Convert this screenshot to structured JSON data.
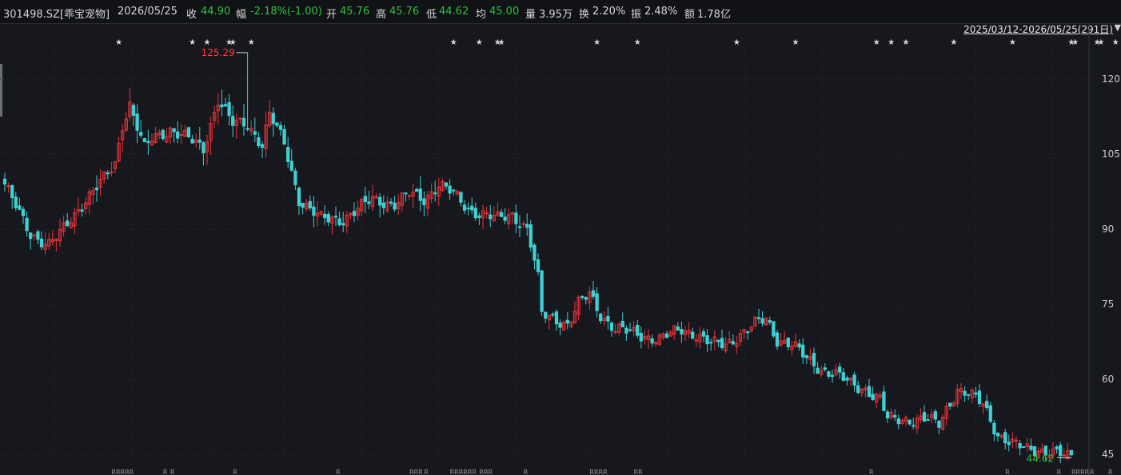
{
  "header": {
    "symbol": "301498.SZ[乖宝宠物]",
    "date": "2026/05/25",
    "close_label": "收",
    "close_value": "44.90",
    "change_label": "幅",
    "change_value": "-2.18%(-1.00)",
    "open_label": "开",
    "open_value": "45.76",
    "high_label": "高",
    "high_value": "45.76",
    "low_label": "低",
    "low_value": "44.62",
    "avg_label": "均",
    "avg_value": "45.00",
    "volume_label": "量",
    "volume_value": "3.95万",
    "turnover_label": "换",
    "turnover_value": "2.20%",
    "amplitude_label": "振",
    "amplitude_value": "2.48%",
    "amount_label": "额",
    "amount_value": "1.78亿",
    "range": "2025/03/12-2026/05/25(291日)"
  },
  "colors": {
    "up": "#e8343a",
    "down": "#3fd0d3",
    "grid": "#2e3138",
    "text": "#cfcfcf",
    "green": "#2ec13e",
    "red": "#ff3b3b"
  },
  "chart_data": {
    "type": "candlestick",
    "y_ticks": [
      45,
      60,
      75,
      90,
      105,
      120
    ],
    "ylim": [
      43.5,
      127
    ],
    "annotations": {
      "max": "125.29",
      "min": "44.62"
    },
    "waypoints": [
      [
        0,
        99
      ],
      [
        4,
        93
      ],
      [
        7,
        89
      ],
      [
        12,
        87
      ],
      [
        15,
        89
      ],
      [
        18,
        92
      ],
      [
        22,
        96
      ],
      [
        27,
        100
      ],
      [
        30,
        103
      ],
      [
        32,
        111
      ],
      [
        34,
        115
      ],
      [
        38,
        106
      ],
      [
        40,
        108
      ],
      [
        45,
        110
      ],
      [
        50,
        108
      ],
      [
        54,
        106
      ],
      [
        56,
        111
      ],
      [
        58,
        116
      ],
      [
        62,
        111
      ],
      [
        66,
        111
      ],
      [
        70,
        107
      ],
      [
        72,
        113
      ],
      [
        76,
        107
      ],
      [
        80,
        96
      ],
      [
        86,
        92
      ],
      [
        92,
        92
      ],
      [
        96,
        94
      ],
      [
        100,
        96
      ],
      [
        106,
        95
      ],
      [
        110,
        97
      ],
      [
        114,
        96
      ],
      [
        118,
        99
      ],
      [
        122,
        97
      ],
      [
        126,
        94
      ],
      [
        130,
        93
      ],
      [
        134,
        92
      ],
      [
        138,
        93
      ],
      [
        142,
        90
      ],
      [
        143,
        87
      ],
      [
        145,
        80
      ],
      [
        146,
        73
      ],
      [
        150,
        72
      ],
      [
        153,
        71
      ],
      [
        156,
        75
      ],
      [
        159,
        77
      ],
      [
        162,
        73
      ],
      [
        166,
        70
      ],
      [
        172,
        69
      ],
      [
        178,
        68
      ],
      [
        184,
        70
      ],
      [
        188,
        69
      ],
      [
        192,
        67
      ],
      [
        196,
        67
      ],
      [
        200,
        69
      ],
      [
        204,
        71
      ],
      [
        207,
        72
      ],
      [
        210,
        68
      ],
      [
        214,
        67
      ],
      [
        218,
        64
      ],
      [
        222,
        62
      ],
      [
        226,
        61
      ],
      [
        230,
        59
      ],
      [
        234,
        58
      ],
      [
        238,
        56
      ],
      [
        240,
        52
      ],
      [
        246,
        52
      ],
      [
        250,
        52
      ],
      [
        254,
        51
      ],
      [
        256,
        54
      ],
      [
        259,
        58
      ],
      [
        262,
        57
      ],
      [
        266,
        55
      ],
      [
        270,
        49
      ],
      [
        274,
        47
      ],
      [
        278,
        46
      ],
      [
        281,
        46
      ]
    ],
    "last_bar": {
      "open": 45.76,
      "high": 45.76,
      "low": 44.62,
      "close": 44.9
    },
    "stars_x": [
      31,
      51,
      55,
      61,
      62,
      67,
      122,
      129,
      134,
      135,
      161,
      172,
      199,
      215,
      237,
      241,
      245,
      258,
      274,
      290,
      291,
      297,
      298,
      302,
      308
    ],
    "r_marks": [
      {
        "i": 29,
        "t": "RRRRR"
      },
      {
        "i": 43,
        "t": "R"
      },
      {
        "i": 45,
        "t": "R"
      },
      {
        "i": 62,
        "t": "R"
      },
      {
        "i": 90,
        "t": "R"
      },
      {
        "i": 110,
        "t": "RRR"
      },
      {
        "i": 114,
        "t": "R"
      },
      {
        "i": 121,
        "t": "RRRRRR"
      },
      {
        "i": 129,
        "t": "RRR"
      },
      {
        "i": 141,
        "t": "R"
      },
      {
        "i": 159,
        "t": "RRRR"
      },
      {
        "i": 171,
        "t": "RR"
      },
      {
        "i": 235,
        "t": "R"
      },
      {
        "i": 272,
        "t": "R"
      },
      {
        "i": 286,
        "t": "R"
      },
      {
        "i": 290,
        "t": "RRRR"
      },
      {
        "i": 295,
        "t": "R"
      },
      {
        "i": 300,
        "t": "R"
      },
      {
        "i": 305,
        "t": "R"
      }
    ],
    "bar_count": 291
  }
}
